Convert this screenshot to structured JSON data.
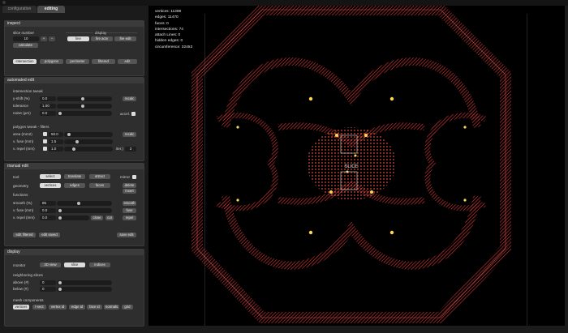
{
  "tabs": [
    "configuration",
    "editing"
  ],
  "inspect": {
    "header": "inspect",
    "slice_label": "slice number",
    "slice_value": "10",
    "display_label": "display",
    "display_buttons": [
      "line",
      "fire actv",
      "fire edit"
    ],
    "calculate": "calculate",
    "view_buttons": [
      "intersection",
      "polygons",
      "perimeter",
      "filtered",
      "edit"
    ]
  },
  "auto_edit": {
    "header": "automated edit",
    "intersection_label": "intersection tweak",
    "rows": [
      {
        "label": "y-shift (%)",
        "value": "0.0"
      },
      {
        "label": "tolerance",
        "value": "1.00"
      },
      {
        "label": "noise (µm)",
        "value": "0.0"
      }
    ],
    "recalc": "recalc",
    "accel": "accel.",
    "polygon_label": "polygon tweak - filters",
    "poly_rows": [
      {
        "label": "area (mm2)",
        "value": "50.0"
      },
      {
        "label": "v. fuse (mm)",
        "value": "1.5"
      },
      {
        "label": "v. repel (mm)",
        "value": "1.0"
      }
    ],
    "iter_label": "iter.)",
    "iter_value": "3"
  },
  "manual_edit": {
    "header": "manual edit",
    "tool_label": "tool",
    "tool_buttons": [
      "select",
      "translate",
      "attract"
    ],
    "mirror": "mirror",
    "geometry_label": "geometry",
    "geometry_buttons": [
      "vertices",
      "edges",
      "faces"
    ],
    "delete": "delete",
    "insert": "insert",
    "functions_label": "functions",
    "fn_rows": [
      {
        "label": "smooth (%)",
        "value": "85"
      },
      {
        "label": "v. fuse (mm)",
        "value": "0.0"
      },
      {
        "label": "v. repel (mm)",
        "value": "0.0"
      }
    ],
    "fn_buttons": [
      "smooth",
      "fuse",
      "repel"
    ],
    "close": "close",
    "cut": "cut",
    "edit_filtered": "edit filtered",
    "edit_saved": "edit saved",
    "save_edit": "save edit"
  },
  "display": {
    "header": "display",
    "monitor_label": "monitor",
    "monitor_buttons": [
      "3D view",
      "slice",
      "indices"
    ],
    "neighbor_label": "neighboring slices",
    "above_label": "above (#)",
    "above_value": "0",
    "below_label": "below (#)",
    "below_value": "0",
    "mesh_label": "mesh components",
    "mesh_buttons": [
      "vertices",
      "l-sect",
      "vertex id",
      "edge id",
      "face id",
      "normals",
      "grid"
    ]
  },
  "stats": [
    "vertices: 11398",
    "edges: 11470",
    "faces: 0",
    "intersections: 74",
    "attach Lines: 0",
    "hidden edges: 0",
    "circumference: 32453"
  ],
  "viewport": {
    "center_label": "SLICE"
  },
  "colors": {
    "mesh": "#e23b3b",
    "highlight": "#ffd84a",
    "bg": "#000000"
  }
}
